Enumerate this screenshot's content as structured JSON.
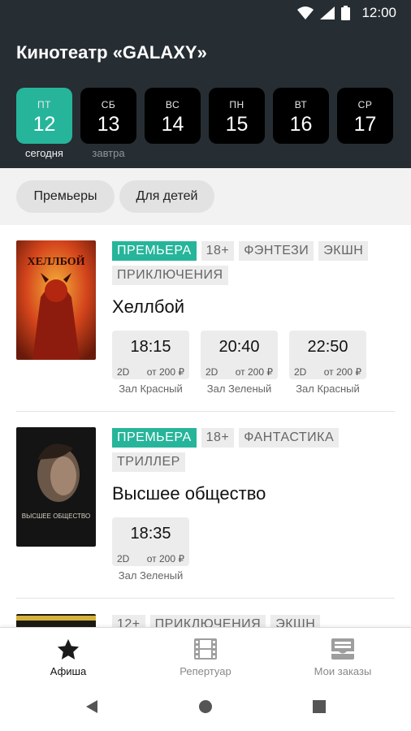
{
  "status": {
    "time": "12:00"
  },
  "header": {
    "title": "Кинотеатр «GALAXY»"
  },
  "dates": [
    {
      "dow": "ПТ",
      "num": "12",
      "active": true
    },
    {
      "dow": "СБ",
      "num": "13"
    },
    {
      "dow": "ВС",
      "num": "14"
    },
    {
      "dow": "ПН",
      "num": "15"
    },
    {
      "dow": "ВТ",
      "num": "16"
    },
    {
      "dow": "СР",
      "num": "17"
    }
  ],
  "date_captions": {
    "today": "сегодня",
    "tomorrow": "завтра"
  },
  "filters": [
    "Премьеры",
    "Для детей"
  ],
  "movies": [
    {
      "tags": [
        "ПРЕМЬЕРА",
        "18+",
        "ФЭНТЕЗИ",
        "ЭКШН",
        "ПРИКЛЮЧЕНИЯ"
      ],
      "title": "Хеллбой",
      "poster_text": "ХЕЛЛБОЙ",
      "showtimes": [
        {
          "time": "18:15",
          "format": "2D",
          "price": "от 200 ₽",
          "hall": "Зал Красный"
        },
        {
          "time": "20:40",
          "format": "2D",
          "price": "от 200 ₽",
          "hall": "Зал Зеленый"
        },
        {
          "time": "22:50",
          "format": "2D",
          "price": "от 200 ₽",
          "hall": "Зал Красный"
        }
      ]
    },
    {
      "tags": [
        "ПРЕМЬЕРА",
        "18+",
        "ФАНТАСТИКА",
        "ТРИЛЛЕР"
      ],
      "title": "Высшее общество",
      "poster_text": "ВЫСШЕЕ ОБЩЕСТВО",
      "showtimes": [
        {
          "time": "18:35",
          "format": "2D",
          "price": "от 200 ₽",
          "hall": "Зал Зеленый"
        }
      ]
    },
    {
      "tags": [
        "12+",
        "ПРИКЛЮЧЕНИЯ",
        "ЭКШН"
      ]
    }
  ],
  "bottom_nav": [
    {
      "label": "Афиша",
      "icon": "star-icon",
      "active": true
    },
    {
      "label": "Репертуар",
      "icon": "film-icon"
    },
    {
      "label": "Мои заказы",
      "icon": "inbox-icon"
    }
  ],
  "colors": {
    "accent": "#26b59a",
    "header_bg": "#262d33"
  }
}
